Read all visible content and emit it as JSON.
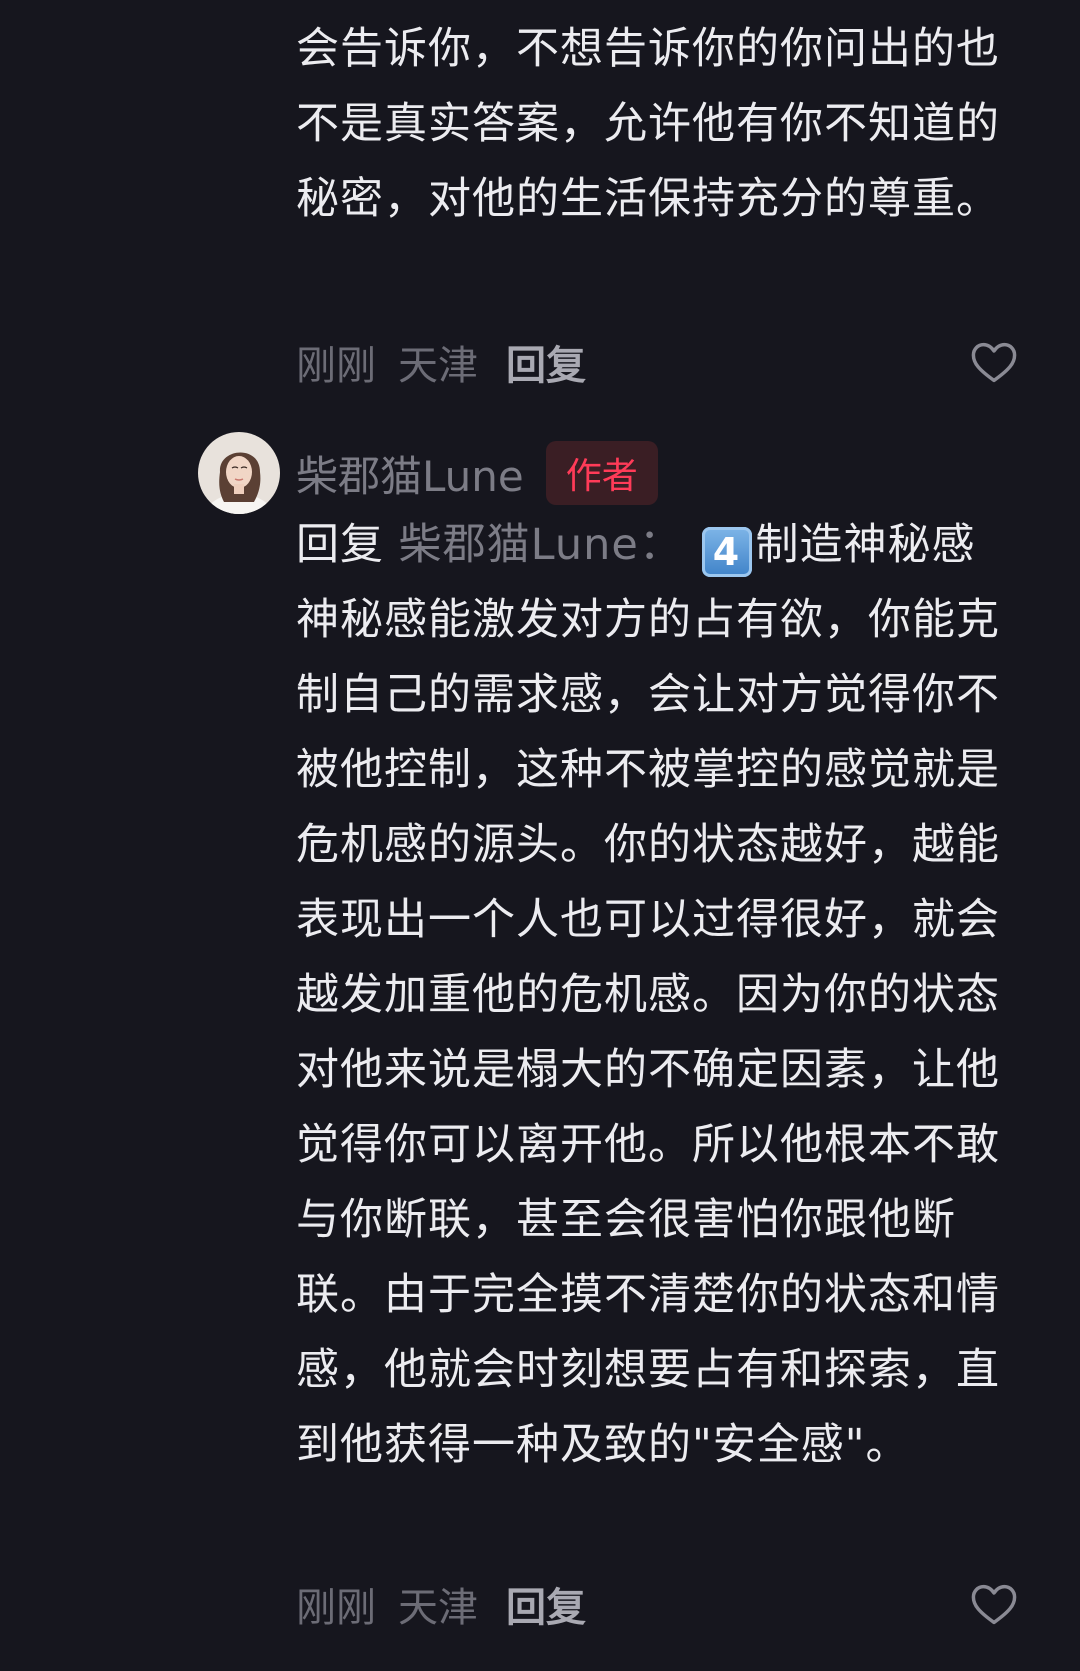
{
  "comment1": {
    "text": "会告诉你，不想告诉你的你问出的也不是真实答案，允许他有你不知道的秘密，对他的生活保持充分的尊重。",
    "time": "刚刚",
    "location": "天津",
    "reply_label": "回复",
    "like_icon": "heart-outline-icon"
  },
  "comment2": {
    "avatar_icon": "user-avatar-photo",
    "username": "柴郡猫Lune",
    "badge": "作者",
    "reply_prefix": "回复",
    "reply_target": "柴郡猫Lune：",
    "emoji": "4",
    "text_title": "制造神秘感",
    "text_body": "神秘感能激发对方的占有欲，你能克制自己的需求感，会让对方觉得你不被他控制，这种不被掌控的感觉就是危机感的源头。你的状态越好，越能表现出一个人也可以过得很好，就会越发加重他的危机感。因为你的状态对他来说是榻大的不确定因素，让他觉得你可以离开他。所以他根本不敢与你断联，甚至会很害怕你跟他断联。由于完全摸不清楚你的状态和情感，他就会时刻想要占有和探索，直到他获得一种及致的\"安全感\"。",
    "time": "刚刚",
    "location": "天津",
    "reply_label": "回复",
    "like_icon": "heart-outline-icon"
  },
  "colors": {
    "background": "#16161e",
    "text": "#ececf0",
    "muted": "#6c6c76",
    "badge_text": "#ff3b58",
    "badge_bg": "#3a1e24"
  }
}
